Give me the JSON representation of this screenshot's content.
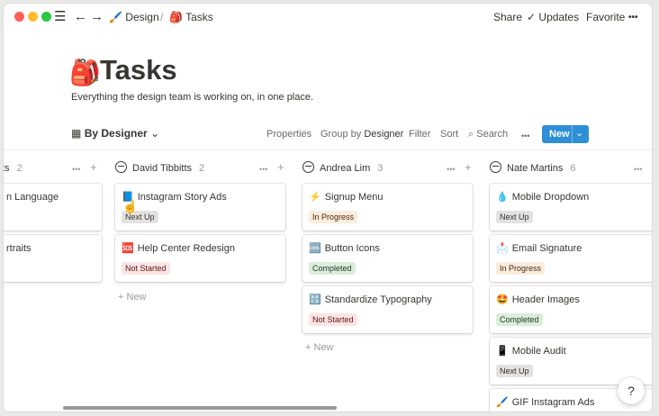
{
  "window": {
    "traffic_lights": {
      "close": "#ff5f57",
      "minimize": "#febc2e",
      "zoom": "#28c840"
    }
  },
  "topbar": {
    "menu_icon": "☰",
    "back_icon": "←",
    "forward_icon": "→",
    "breadcrumb": [
      {
        "icon": "🖌️",
        "label": "Design"
      },
      {
        "icon": "🎒",
        "label": "Tasks"
      }
    ],
    "separator": "/",
    "share_label": "Share",
    "updates_icon": "✓",
    "updates_label": "Updates",
    "favorite_label": "Favorite",
    "more_icon": "•••"
  },
  "page": {
    "icon": "🎒",
    "title": "Tasks",
    "description": "Everything the design team is working on, in one place."
  },
  "toolbar": {
    "view_icon": "▦",
    "view_label": "By Designer",
    "view_caret": "⌄",
    "properties_label": "Properties",
    "group_by_prefix": "Group by",
    "group_by_value": "Designer",
    "filter_label": "Filter",
    "sort_label": "Sort",
    "search_icon": "⌕",
    "search_label": "Search",
    "more_icon": "•••",
    "new_label": "New",
    "new_caret": "⌄",
    "accent": "#2e8fd6"
  },
  "board": {
    "columns": [
      {
        "name": "ts",
        "count": "2",
        "cards": [
          {
            "icon": "",
            "title": "n Language",
            "tag": ""
          },
          {
            "icon": "",
            "title": "rtraits",
            "tag": ""
          }
        ]
      },
      {
        "name": "David Tibbitts",
        "count": "2",
        "cards": [
          {
            "icon": "📘",
            "title": "Instagram Story Ads",
            "tag": "Next Up"
          },
          {
            "icon": "🆘",
            "title": "Help Center Redesign",
            "tag": "Not Started"
          }
        ],
        "add_label": "New"
      },
      {
        "name": "Andrea Lim",
        "count": "3",
        "cards": [
          {
            "icon": "⚡",
            "title": "Signup Menu",
            "tag": "In Progress"
          },
          {
            "icon": "🆒",
            "title": "Button Icons",
            "tag": "Completed"
          },
          {
            "icon": "🔠",
            "title": "Standardize Typography",
            "tag": "Not Started"
          }
        ],
        "add_label": "New"
      },
      {
        "name": "Nate Martins",
        "count": "6",
        "cards": [
          {
            "icon": "💧",
            "title": "Mobile Dropdown",
            "tag": "Next Up"
          },
          {
            "icon": "📩",
            "title": "Email Signature",
            "tag": "In Progress"
          },
          {
            "icon": "🤩",
            "title": "Header Images",
            "tag": "Completed"
          },
          {
            "icon": "📱",
            "title": "Mobile Audit",
            "tag": "Next Up"
          },
          {
            "icon": "🖌️",
            "title": "GIF Instagram Ads",
            "tag": ""
          }
        ]
      }
    ],
    "column_more_icon": "•••",
    "column_add_icon": "+",
    "add_icon": "+"
  },
  "help": {
    "label": "?"
  },
  "cursor_icon": "☝"
}
